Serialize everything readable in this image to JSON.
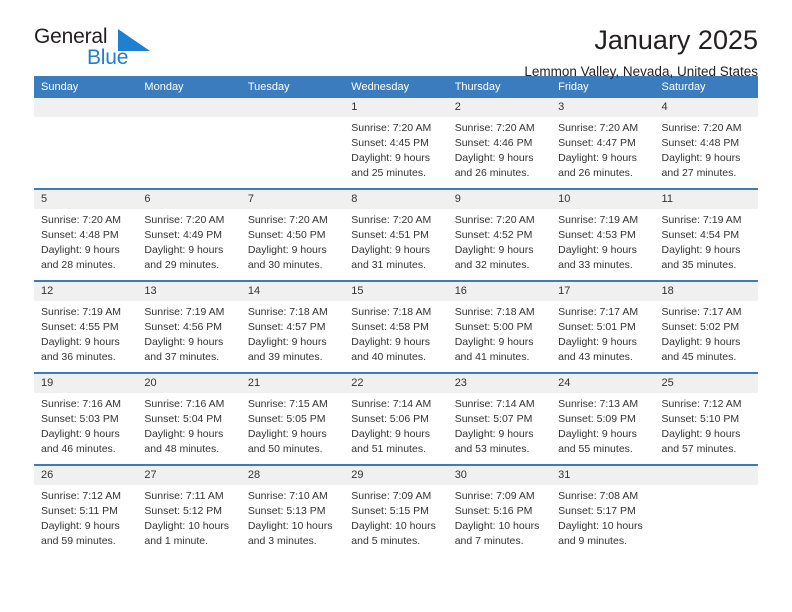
{
  "brand": {
    "name_part1": "General",
    "name_part2": "Blue",
    "triangle_color": "#1f7fd0",
    "text_color": "#231f20"
  },
  "header": {
    "title": "January 2025",
    "subtitle": "Lemmon Valley, Nevada, United States"
  },
  "theme": {
    "header_bg": "#3b7cbf",
    "header_text": "#ffffff",
    "daynum_bg": "#f0f0f0",
    "row_divider": "#3b7cbf",
    "body_text": "#333333"
  },
  "weekdays": [
    "Sunday",
    "Monday",
    "Tuesday",
    "Wednesday",
    "Thursday",
    "Friday",
    "Saturday"
  ],
  "labels": {
    "sunrise_prefix": "Sunrise: ",
    "sunset_prefix": "Sunset: ",
    "daylight_prefix": "Daylight: "
  },
  "weeks": [
    [
      {
        "empty": true
      },
      {
        "empty": true
      },
      {
        "empty": true
      },
      {
        "day": "1",
        "sunrise": "Sunrise: 7:20 AM",
        "sunset": "Sunset: 4:45 PM",
        "daylight_line1": "Daylight: 9 hours",
        "daylight_line2": "and 25 minutes."
      },
      {
        "day": "2",
        "sunrise": "Sunrise: 7:20 AM",
        "sunset": "Sunset: 4:46 PM",
        "daylight_line1": "Daylight: 9 hours",
        "daylight_line2": "and 26 minutes."
      },
      {
        "day": "3",
        "sunrise": "Sunrise: 7:20 AM",
        "sunset": "Sunset: 4:47 PM",
        "daylight_line1": "Daylight: 9 hours",
        "daylight_line2": "and 26 minutes."
      },
      {
        "day": "4",
        "sunrise": "Sunrise: 7:20 AM",
        "sunset": "Sunset: 4:48 PM",
        "daylight_line1": "Daylight: 9 hours",
        "daylight_line2": "and 27 minutes."
      }
    ],
    [
      {
        "day": "5",
        "sunrise": "Sunrise: 7:20 AM",
        "sunset": "Sunset: 4:48 PM",
        "daylight_line1": "Daylight: 9 hours",
        "daylight_line2": "and 28 minutes."
      },
      {
        "day": "6",
        "sunrise": "Sunrise: 7:20 AM",
        "sunset": "Sunset: 4:49 PM",
        "daylight_line1": "Daylight: 9 hours",
        "daylight_line2": "and 29 minutes."
      },
      {
        "day": "7",
        "sunrise": "Sunrise: 7:20 AM",
        "sunset": "Sunset: 4:50 PM",
        "daylight_line1": "Daylight: 9 hours",
        "daylight_line2": "and 30 minutes."
      },
      {
        "day": "8",
        "sunrise": "Sunrise: 7:20 AM",
        "sunset": "Sunset: 4:51 PM",
        "daylight_line1": "Daylight: 9 hours",
        "daylight_line2": "and 31 minutes."
      },
      {
        "day": "9",
        "sunrise": "Sunrise: 7:20 AM",
        "sunset": "Sunset: 4:52 PM",
        "daylight_line1": "Daylight: 9 hours",
        "daylight_line2": "and 32 minutes."
      },
      {
        "day": "10",
        "sunrise": "Sunrise: 7:19 AM",
        "sunset": "Sunset: 4:53 PM",
        "daylight_line1": "Daylight: 9 hours",
        "daylight_line2": "and 33 minutes."
      },
      {
        "day": "11",
        "sunrise": "Sunrise: 7:19 AM",
        "sunset": "Sunset: 4:54 PM",
        "daylight_line1": "Daylight: 9 hours",
        "daylight_line2": "and 35 minutes."
      }
    ],
    [
      {
        "day": "12",
        "sunrise": "Sunrise: 7:19 AM",
        "sunset": "Sunset: 4:55 PM",
        "daylight_line1": "Daylight: 9 hours",
        "daylight_line2": "and 36 minutes."
      },
      {
        "day": "13",
        "sunrise": "Sunrise: 7:19 AM",
        "sunset": "Sunset: 4:56 PM",
        "daylight_line1": "Daylight: 9 hours",
        "daylight_line2": "and 37 minutes."
      },
      {
        "day": "14",
        "sunrise": "Sunrise: 7:18 AM",
        "sunset": "Sunset: 4:57 PM",
        "daylight_line1": "Daylight: 9 hours",
        "daylight_line2": "and 39 minutes."
      },
      {
        "day": "15",
        "sunrise": "Sunrise: 7:18 AM",
        "sunset": "Sunset: 4:58 PM",
        "daylight_line1": "Daylight: 9 hours",
        "daylight_line2": "and 40 minutes."
      },
      {
        "day": "16",
        "sunrise": "Sunrise: 7:18 AM",
        "sunset": "Sunset: 5:00 PM",
        "daylight_line1": "Daylight: 9 hours",
        "daylight_line2": "and 41 minutes."
      },
      {
        "day": "17",
        "sunrise": "Sunrise: 7:17 AM",
        "sunset": "Sunset: 5:01 PM",
        "daylight_line1": "Daylight: 9 hours",
        "daylight_line2": "and 43 minutes."
      },
      {
        "day": "18",
        "sunrise": "Sunrise: 7:17 AM",
        "sunset": "Sunset: 5:02 PM",
        "daylight_line1": "Daylight: 9 hours",
        "daylight_line2": "and 45 minutes."
      }
    ],
    [
      {
        "day": "19",
        "sunrise": "Sunrise: 7:16 AM",
        "sunset": "Sunset: 5:03 PM",
        "daylight_line1": "Daylight: 9 hours",
        "daylight_line2": "and 46 minutes."
      },
      {
        "day": "20",
        "sunrise": "Sunrise: 7:16 AM",
        "sunset": "Sunset: 5:04 PM",
        "daylight_line1": "Daylight: 9 hours",
        "daylight_line2": "and 48 minutes."
      },
      {
        "day": "21",
        "sunrise": "Sunrise: 7:15 AM",
        "sunset": "Sunset: 5:05 PM",
        "daylight_line1": "Daylight: 9 hours",
        "daylight_line2": "and 50 minutes."
      },
      {
        "day": "22",
        "sunrise": "Sunrise: 7:14 AM",
        "sunset": "Sunset: 5:06 PM",
        "daylight_line1": "Daylight: 9 hours",
        "daylight_line2": "and 51 minutes."
      },
      {
        "day": "23",
        "sunrise": "Sunrise: 7:14 AM",
        "sunset": "Sunset: 5:07 PM",
        "daylight_line1": "Daylight: 9 hours",
        "daylight_line2": "and 53 minutes."
      },
      {
        "day": "24",
        "sunrise": "Sunrise: 7:13 AM",
        "sunset": "Sunset: 5:09 PM",
        "daylight_line1": "Daylight: 9 hours",
        "daylight_line2": "and 55 minutes."
      },
      {
        "day": "25",
        "sunrise": "Sunrise: 7:12 AM",
        "sunset": "Sunset: 5:10 PM",
        "daylight_line1": "Daylight: 9 hours",
        "daylight_line2": "and 57 minutes."
      }
    ],
    [
      {
        "day": "26",
        "sunrise": "Sunrise: 7:12 AM",
        "sunset": "Sunset: 5:11 PM",
        "daylight_line1": "Daylight: 9 hours",
        "daylight_line2": "and 59 minutes."
      },
      {
        "day": "27",
        "sunrise": "Sunrise: 7:11 AM",
        "sunset": "Sunset: 5:12 PM",
        "daylight_line1": "Daylight: 10 hours",
        "daylight_line2": "and 1 minute."
      },
      {
        "day": "28",
        "sunrise": "Sunrise: 7:10 AM",
        "sunset": "Sunset: 5:13 PM",
        "daylight_line1": "Daylight: 10 hours",
        "daylight_line2": "and 3 minutes."
      },
      {
        "day": "29",
        "sunrise": "Sunrise: 7:09 AM",
        "sunset": "Sunset: 5:15 PM",
        "daylight_line1": "Daylight: 10 hours",
        "daylight_line2": "and 5 minutes."
      },
      {
        "day": "30",
        "sunrise": "Sunrise: 7:09 AM",
        "sunset": "Sunset: 5:16 PM",
        "daylight_line1": "Daylight: 10 hours",
        "daylight_line2": "and 7 minutes."
      },
      {
        "day": "31",
        "sunrise": "Sunrise: 7:08 AM",
        "sunset": "Sunset: 5:17 PM",
        "daylight_line1": "Daylight: 10 hours",
        "daylight_line2": "and 9 minutes."
      },
      {
        "empty": true
      }
    ]
  ]
}
